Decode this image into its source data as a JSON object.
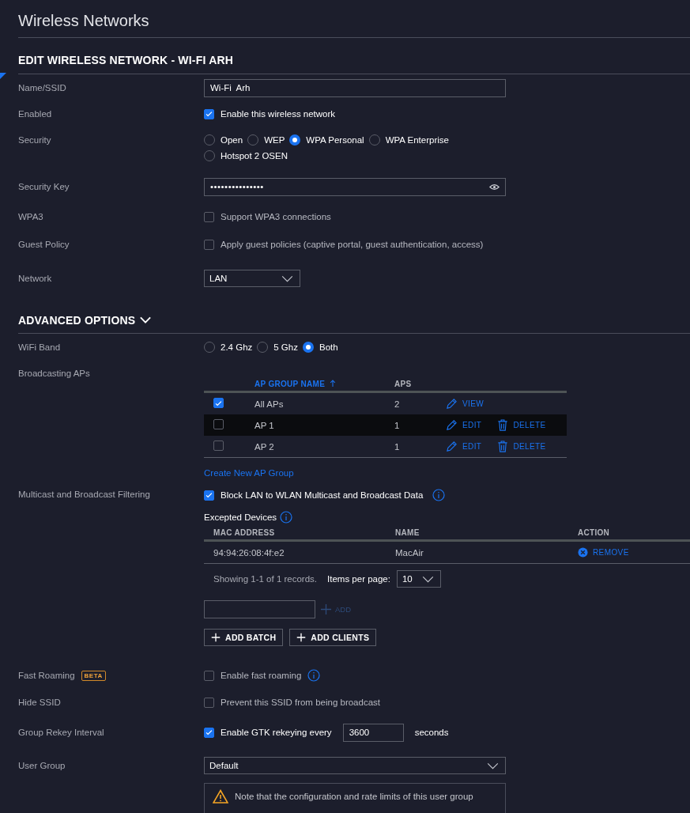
{
  "page": {
    "title": "Wireless Networks"
  },
  "form": {
    "heading": "EDIT WIRELESS NETWORK - WI-FI ARH",
    "name": {
      "label": "Name/SSID",
      "value": "Wi-Fi  Arh"
    },
    "enabled": {
      "label": "Enabled",
      "text": "Enable this wireless network",
      "checked": true
    },
    "security": {
      "label": "Security",
      "options": [
        {
          "label": "Open",
          "selected": false
        },
        {
          "label": "WEP",
          "selected": false
        },
        {
          "label": "WPA Personal",
          "selected": true
        },
        {
          "label": "WPA Enterprise",
          "selected": false
        },
        {
          "label": "Hotspot 2 OSEN",
          "selected": false
        }
      ]
    },
    "security_key": {
      "label": "Security Key",
      "value": "•••••••••••••••"
    },
    "wpa3": {
      "label": "WPA3",
      "text": "Support WPA3 connections",
      "checked": false
    },
    "guest_policy": {
      "label": "Guest Policy",
      "text": "Apply guest policies (captive portal, guest authentication, access)",
      "checked": false
    },
    "network": {
      "label": "Network",
      "value": "LAN"
    }
  },
  "advanced": {
    "heading": "ADVANCED OPTIONS",
    "expanded": true,
    "wifi_band": {
      "label": "WiFi Band",
      "options": [
        {
          "label": "2.4 Ghz",
          "selected": false
        },
        {
          "label": "5 Ghz",
          "selected": false
        },
        {
          "label": "Both",
          "selected": true
        }
      ]
    },
    "broadcasting": {
      "label": "Broadcasting APs",
      "columns": [
        "AP GROUP NAME",
        "APS"
      ],
      "rows": [
        {
          "checked": true,
          "highlighted": false,
          "name": "All APs",
          "aps": "2",
          "actions": [
            {
              "kind": "view",
              "label": "VIEW"
            }
          ]
        },
        {
          "checked": false,
          "highlighted": true,
          "name": "AP 1",
          "aps": "1",
          "actions": [
            {
              "kind": "edit",
              "label": "EDIT"
            },
            {
              "kind": "delete",
              "label": "DELETE"
            }
          ]
        },
        {
          "checked": false,
          "highlighted": false,
          "name": "AP 2",
          "aps": "1",
          "actions": [
            {
              "kind": "edit",
              "label": "EDIT"
            },
            {
              "kind": "delete",
              "label": "DELETE"
            }
          ]
        }
      ],
      "create_link": "Create New AP Group"
    },
    "multicast": {
      "label": "Multicast and Broadcast Filtering",
      "text": "Block LAN to WLAN Multicast and Broadcast Data",
      "checked": true,
      "excepted_title": "Excepted Devices",
      "columns": [
        "MAC ADDRESS",
        "NAME",
        "ACTION"
      ],
      "rows": [
        {
          "mac": "94:94:26:08:4f:e2",
          "name": "MacAir",
          "action": "REMOVE"
        }
      ],
      "summary": "Showing 1-1 of 1 records.",
      "per_page_label": "Items per page:",
      "per_page": "10",
      "add": {
        "label": "ADD",
        "disabled": true
      },
      "buttons": [
        "ADD BATCH",
        "ADD CLIENTS"
      ]
    },
    "fast_roaming": {
      "label": "Fast Roaming",
      "badge": "BETA",
      "text": "Enable fast roaming",
      "checked": false
    },
    "hide_ssid": {
      "label": "Hide SSID",
      "text": "Prevent this SSID from being broadcast",
      "checked": false
    },
    "rekey": {
      "label": "Group Rekey Interval",
      "text": "Enable GTK rekeying every",
      "checked": true,
      "value": "3600",
      "unit": "seconds"
    },
    "user_group": {
      "label": "User Group",
      "value": "Default",
      "note": "Note that the configuration and rate limits of this user group"
    }
  }
}
